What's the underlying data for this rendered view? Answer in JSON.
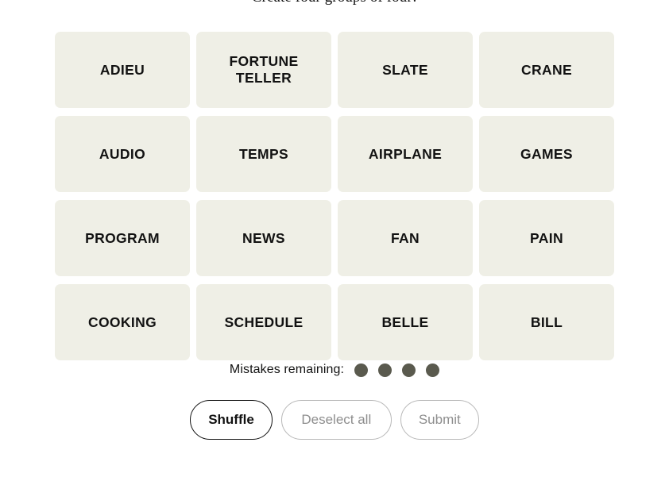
{
  "title": "Create four groups of four!",
  "grid": {
    "rows": [
      [
        {
          "label": "ADIEU",
          "lines": [
            "ADIEU"
          ]
        },
        {
          "label": "FORTUNE TELLER",
          "lines": [
            "FORTUNE",
            "TELLER"
          ]
        },
        {
          "label": "SLATE",
          "lines": [
            "SLATE"
          ]
        },
        {
          "label": "CRANE",
          "lines": [
            "CRANE"
          ]
        }
      ],
      [
        {
          "label": "AUDIO",
          "lines": [
            "AUDIO"
          ]
        },
        {
          "label": "TEMPS",
          "lines": [
            "TEMPS"
          ]
        },
        {
          "label": "AIRPLANE",
          "lines": [
            "AIRPLANE"
          ]
        },
        {
          "label": "GAMES",
          "lines": [
            "GAMES"
          ]
        }
      ],
      [
        {
          "label": "PROGRAM",
          "lines": [
            "PROGRAM"
          ]
        },
        {
          "label": "NEWS",
          "lines": [
            "NEWS"
          ]
        },
        {
          "label": "FAN",
          "lines": [
            "FAN"
          ]
        },
        {
          "label": "PAIN",
          "lines": [
            "PAIN"
          ]
        }
      ],
      [
        {
          "label": "COOKING",
          "lines": [
            "COOKING"
          ]
        },
        {
          "label": "SCHEDULE",
          "lines": [
            "SCHEDULE"
          ]
        },
        {
          "label": "BELLE",
          "lines": [
            "BELLE"
          ]
        },
        {
          "label": "BILL",
          "lines": [
            "BILL"
          ]
        }
      ]
    ]
  },
  "mistakes": {
    "label": "Mistakes remaining:",
    "remaining": 4,
    "dot_color": "#5a5a4e"
  },
  "buttons": {
    "shuffle": {
      "label": "Shuffle",
      "state": "active"
    },
    "deselect_all": {
      "label": "Deselect all",
      "state": "inactive"
    },
    "submit": {
      "label": "Submit",
      "state": "inactive"
    }
  },
  "colors": {
    "page_background": "#ffffff",
    "tile_background": "#efefe6",
    "text": "#121212",
    "muted_text": "#8e8e8e",
    "muted_border": "#b8b8b8"
  }
}
